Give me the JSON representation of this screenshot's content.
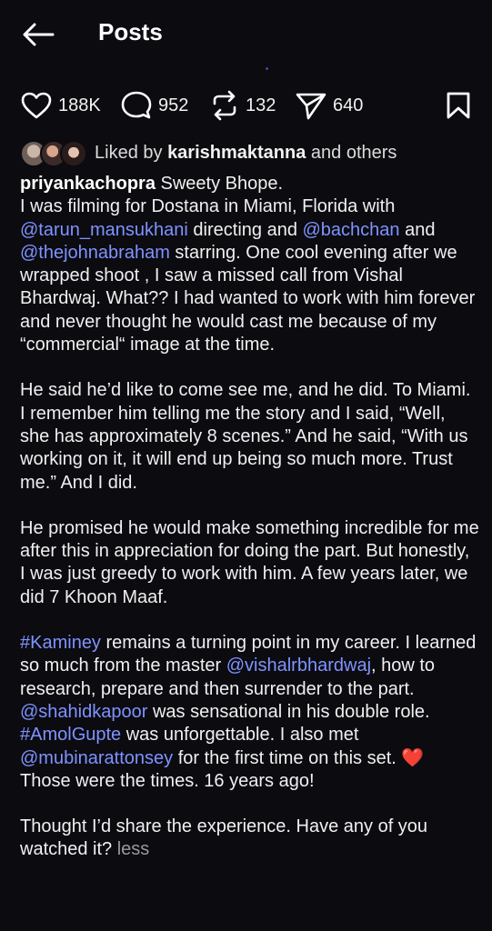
{
  "header": {
    "title": "Posts"
  },
  "actions": {
    "likes": "188K",
    "comments": "952",
    "reposts": "132",
    "shares": "640"
  },
  "liked_by": {
    "prefix": "Liked by ",
    "user": "karishmaktanna",
    "suffix": " and others"
  },
  "caption": {
    "username": "priyankachopra",
    "p1": [
      {
        "t": " Sweety Bhope.\nI was filming for Dostana in Miami, Florida with "
      },
      {
        "t": "@tarun_mansukhani",
        "tag": true
      },
      {
        "t": " directing and "
      },
      {
        "t": "@bachchan",
        "tag": true
      },
      {
        "t": " and "
      },
      {
        "t": "@thejohnabraham",
        "tag": true
      },
      {
        "t": " starring. One cool evening after we wrapped shoot , I saw a missed call from Vishal Bhardwaj. What?? I had wanted to work with him forever and never thought he would cast me because of my “commercial“ image at the time."
      }
    ],
    "p2": "He said he’d like to come see me, and he did. To Miami. I remember him telling me the story and I said, “Well, she has approximately 8 scenes.” And he said, “With us working on it, it will end up being so much more. Trust me.” And I did.",
    "p3": "He promised he would make something incredible for me after this in appreciation for doing the part. But honestly, I was just greedy to work with him. A few years later, we did 7 Khoon Maaf.",
    "p4": [
      {
        "t": "#Kaminey",
        "tag": true
      },
      {
        "t": " remains a turning point in my career. I learned so much from the master "
      },
      {
        "t": "@vishalrbhardwaj",
        "tag": true
      },
      {
        "t": ", how to research, prepare and then surrender to the part. "
      },
      {
        "t": "@shahidkapoor",
        "tag": true
      },
      {
        "t": " was sensational in his double role. "
      },
      {
        "t": "#AmolGupte",
        "tag": true
      },
      {
        "t": " was unforgettable. I also met "
      },
      {
        "t": "@mubinarattonsey",
        "tag": true
      },
      {
        "t": " for the first time on this set. "
      },
      {
        "t": "❤️",
        "emoji": true
      },
      {
        "t": "\nThose were the times. 16 years ago!"
      }
    ],
    "p5": "Thought I’d share the experience. Have any of you watched it? ",
    "less": "less"
  },
  "colors": {
    "background": "#0b0b10",
    "link": "#7f93ff",
    "muted": "#9a9a9a"
  },
  "icons": [
    "back-arrow-icon",
    "heart-icon",
    "comment-icon",
    "repost-icon",
    "share-icon",
    "bookmark-icon"
  ]
}
